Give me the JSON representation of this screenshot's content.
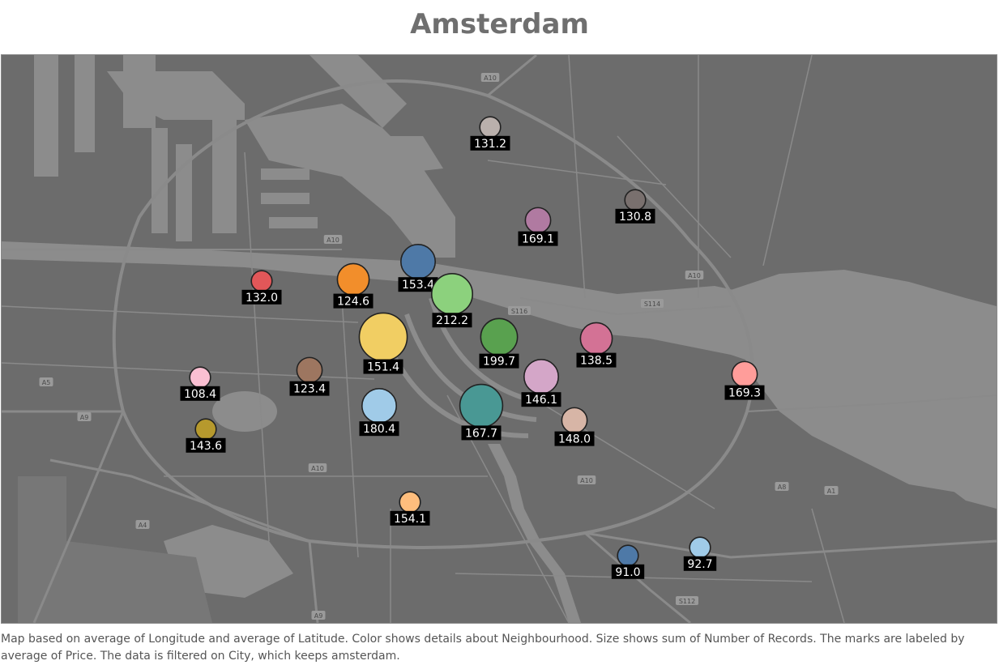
{
  "title": "Amsterdam",
  "caption": "Map based on average of Longitude and average of Latitude.  Color shows details about Neighbourhood.  Size shows sum of Number of Records.  The marks are labeled by average of Price. The data is filtered on City, which keeps amsterdam.",
  "map": {
    "background_color": "#6c6c6c",
    "water_color": "#8c8c8c",
    "road_color": "#8a8a8a",
    "road_labels": [
      "A10",
      "A10",
      "A10",
      "A10",
      "A10",
      "S116",
      "S114",
      "A5",
      "A9",
      "A4",
      "A9",
      "A1",
      "S112",
      "A8"
    ]
  },
  "chart_data": {
    "type": "scatter",
    "title": "Amsterdam",
    "marks": [
      {
        "label": "131.2",
        "color": "#bab0ac",
        "size": 1
      },
      {
        "label": "130.8",
        "color": "#79706e",
        "size": 1
      },
      {
        "label": "169.1",
        "color": "#b07aa1",
        "size": 2
      },
      {
        "label": "132.0",
        "color": "#e15759",
        "size": 1
      },
      {
        "label": "124.6",
        "color": "#f28e2b",
        "size": 4
      },
      {
        "label": "153.4",
        "color": "#4e79a7",
        "size": 5
      },
      {
        "label": "212.2",
        "color": "#8cd17d",
        "size": 8
      },
      {
        "label": "151.4",
        "color": "#f1ce63",
        "size": 12
      },
      {
        "label": "199.7",
        "color": "#59a14f",
        "size": 6
      },
      {
        "label": "138.5",
        "color": "#d37295",
        "size": 4
      },
      {
        "label": "108.4",
        "color": "#fabfd2",
        "size": 1
      },
      {
        "label": "123.4",
        "color": "#9d7660",
        "size": 2
      },
      {
        "label": "146.1",
        "color": "#d4a6c8",
        "size": 5
      },
      {
        "label": "169.3",
        "color": "#ff9d9a",
        "size": 2
      },
      {
        "label": "180.4",
        "color": "#a0cbe8",
        "size": 5
      },
      {
        "label": "167.7",
        "color": "#499894",
        "size": 9
      },
      {
        "label": "148.0",
        "color": "#d7b5a6",
        "size": 2
      },
      {
        "label": "143.6",
        "color": "#b6992d",
        "size": 1
      },
      {
        "label": "154.1",
        "color": "#ffbe7d",
        "size": 1
      },
      {
        "label": "91.0",
        "color": "#4e79a7",
        "size": 1
      },
      {
        "label": "92.7",
        "color": "#a0cbe8",
        "size": 1
      }
    ]
  }
}
